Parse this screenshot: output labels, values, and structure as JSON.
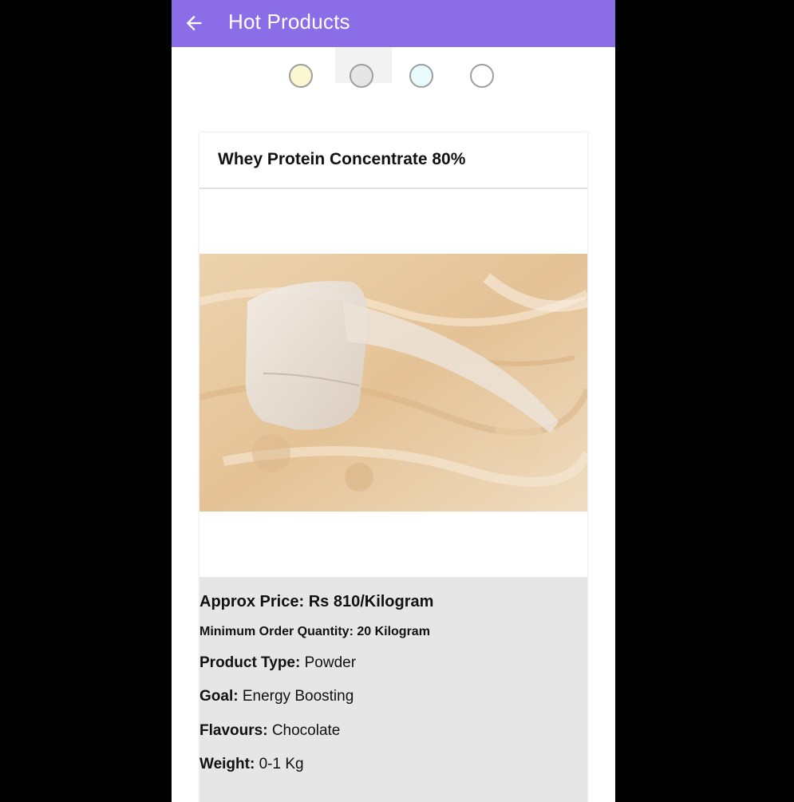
{
  "appbar": {
    "title": "Hot Products",
    "back_icon": "arrow-left-icon",
    "color": "#8a6de7"
  },
  "color_swatches": [
    {
      "name": "light-yellow",
      "color": "#fbf8d0"
    },
    {
      "name": "light-grey",
      "color": "#e6e6e6"
    },
    {
      "name": "light-cyan",
      "color": "#e8fbfd"
    },
    {
      "name": "white",
      "color": "#ffffff"
    }
  ],
  "product": {
    "title": "Whey Protein Concentrate 80%",
    "approx_price": "Approx Price: Rs 810/Kilogram",
    "min_order": "Minimum Order Quantity: 20 Kilogram",
    "specs": [
      {
        "label": "Product Type:",
        "value": "Powder"
      },
      {
        "label": "Goal:",
        "value": "Energy Boosting"
      },
      {
        "label": "Flavours:",
        "value": "Chocolate"
      },
      {
        "label": "Weight:",
        "value": "0-1 Kg"
      }
    ]
  }
}
